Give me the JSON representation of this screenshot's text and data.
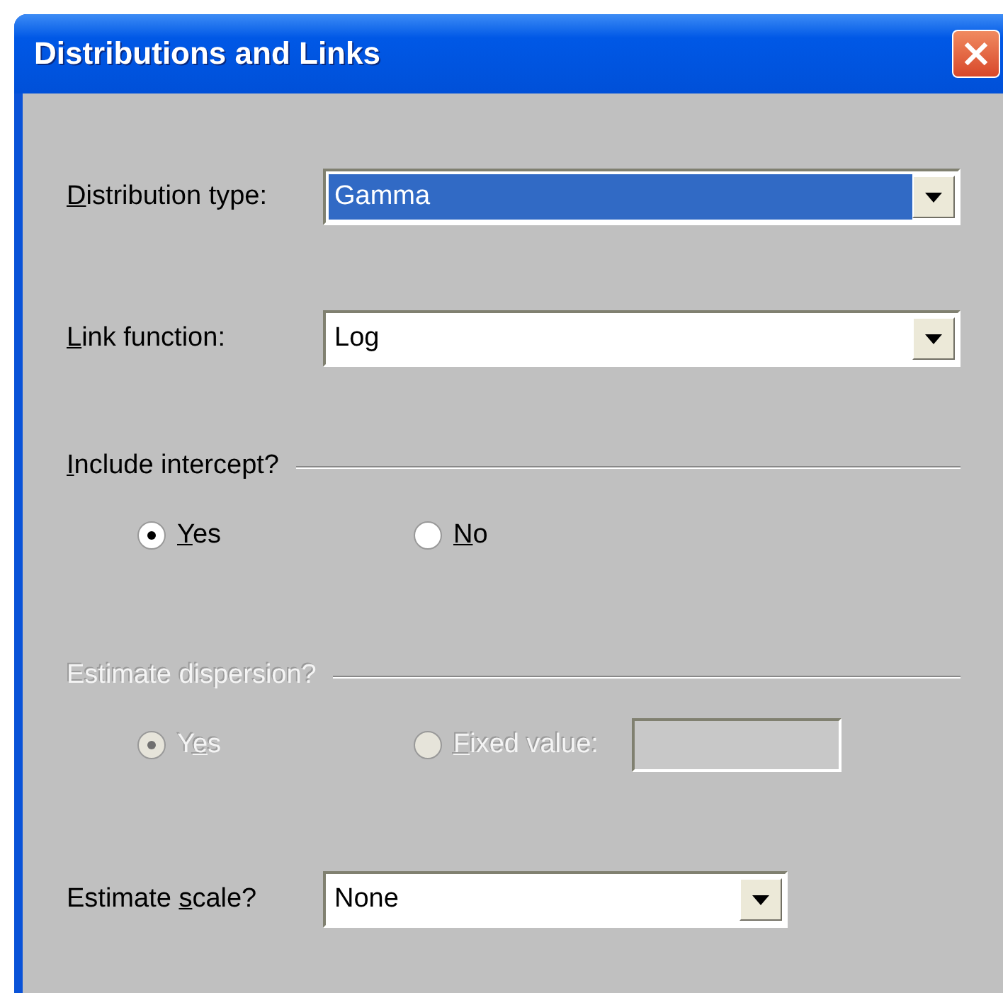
{
  "window": {
    "title": "Distributions and Links"
  },
  "fields": [
    {
      "kind": "combo",
      "label_parts": [
        {
          "text": "D",
          "underline": true
        },
        {
          "text": "istribution type:",
          "underline": false
        }
      ],
      "value": "Gamma",
      "highlighted": true
    },
    {
      "kind": "combo",
      "label_parts": [
        {
          "text": "L",
          "underline": true
        },
        {
          "text": "ink function:",
          "underline": false
        }
      ],
      "value": "Log",
      "highlighted": false
    }
  ],
  "groups": [
    {
      "label_parts": [
        {
          "text": "I",
          "underline": true
        },
        {
          "text": "nclude intercept?",
          "underline": false
        }
      ],
      "disabled": false,
      "options": [
        {
          "kind": "radio",
          "label_parts": [
            {
              "text": "Y",
              "underline": true
            },
            {
              "text": "es",
              "underline": false
            }
          ],
          "selected": true
        },
        {
          "kind": "radio",
          "label_parts": [
            {
              "text": "N",
              "underline": true
            },
            {
              "text": "o",
              "underline": false
            }
          ],
          "selected": false
        }
      ]
    },
    {
      "label_parts": [
        {
          "text": "Estimate dispersion?",
          "underline": false
        }
      ],
      "disabled": true,
      "options": [
        {
          "kind": "radio",
          "label_parts": [
            {
              "text": "Y",
              "underline": false
            },
            {
              "text": "e",
              "underline": true
            },
            {
              "text": "s",
              "underline": false
            }
          ],
          "selected": true
        },
        {
          "kind": "radio_input",
          "label_parts": [
            {
              "text": "F",
              "underline": true
            },
            {
              "text": "ixed value:",
              "underline": false
            }
          ],
          "selected": false
        }
      ]
    }
  ],
  "scale": {
    "kind": "combo",
    "label_parts": [
      {
        "text": "Estimate ",
        "underline": false
      },
      {
        "text": "s",
        "underline": true
      },
      {
        "text": "cale?",
        "underline": false
      }
    ],
    "value": "None",
    "highlighted": false
  }
}
